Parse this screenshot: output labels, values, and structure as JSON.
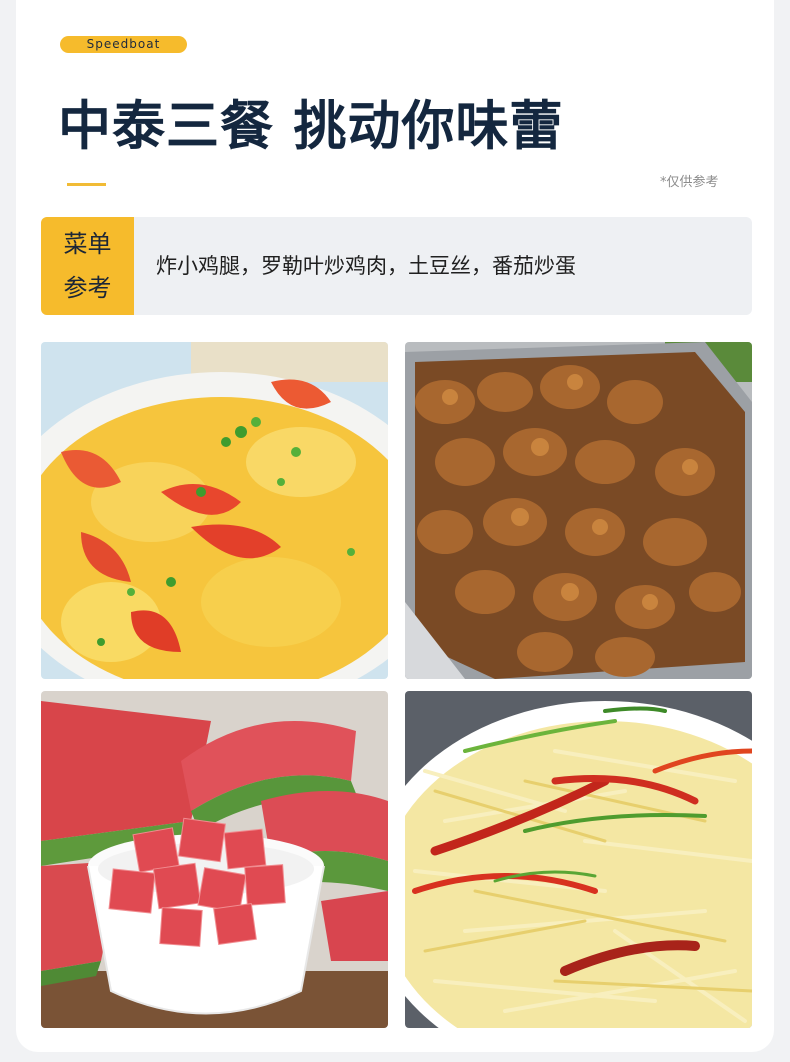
{
  "header": {
    "badge": "Speedboat",
    "title": "中泰三餐 挑动你味蕾",
    "note": "*仅供参考"
  },
  "menu": {
    "tag_line1": "菜单",
    "tag_line2": "参考",
    "items_text": "炸小鸡腿，罗勒叶炒鸡肉，土豆丝，番茄炒蛋"
  },
  "photos": [
    {
      "dish": "tomato-egg"
    },
    {
      "dish": "fried-chicken-drumsticks"
    },
    {
      "dish": "watermelon"
    },
    {
      "dish": "potato-shreds"
    }
  ],
  "colors": {
    "accent": "#f6bb2c",
    "title": "#14273f",
    "panel": "#eef0f3"
  }
}
